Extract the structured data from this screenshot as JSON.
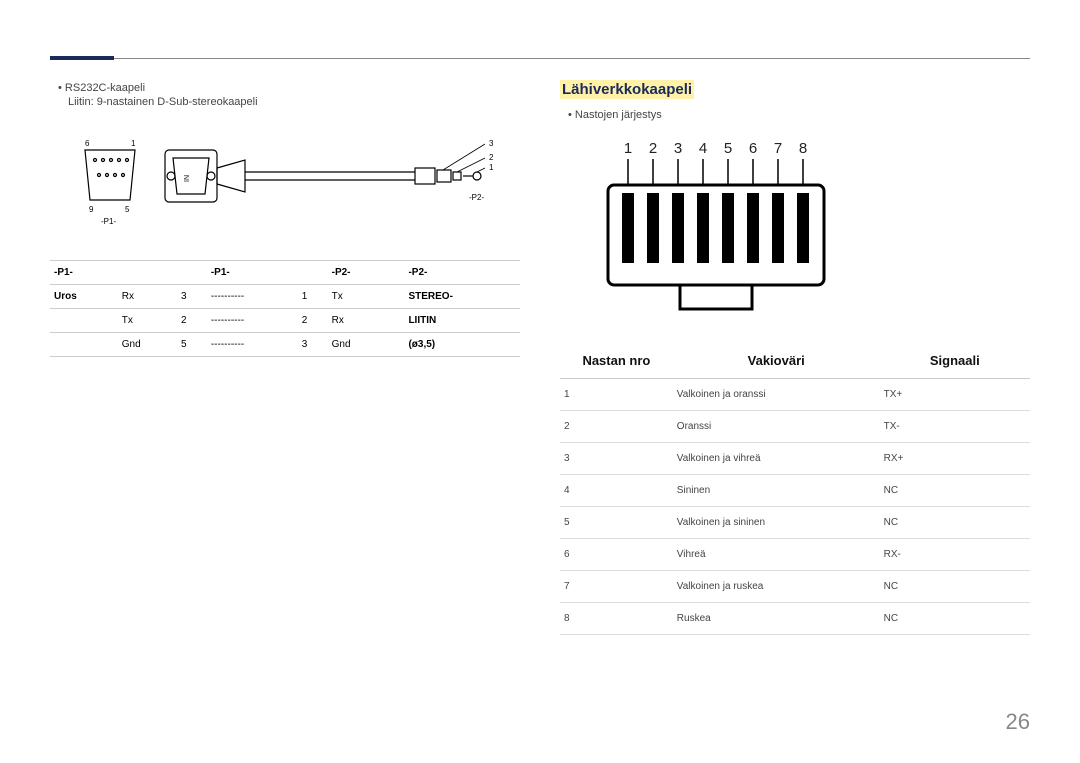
{
  "page_number": "26",
  "left": {
    "bullet": "RS232C-kaapeli",
    "subline": "Liitin: 9-nastainen D-Sub-stereokaapeli",
    "diagram": {
      "p1_label": "-P1-",
      "p2_label": "-P2-",
      "pin_labels_left": [
        "1",
        "5",
        "6",
        "9"
      ],
      "pin_labels_right": [
        "1",
        "2",
        "3"
      ]
    },
    "table": {
      "headers": [
        "-P1-",
        "-P1-",
        "-P2-",
        "-P2-"
      ],
      "col0_header": "Uros",
      "col7_header_rows": [
        "STEREO-",
        "LIITIN",
        "(ø3,5)"
      ],
      "rows": [
        [
          "Rx",
          "3",
          "----------",
          "1",
          "Tx"
        ],
        [
          "Tx",
          "2",
          "----------",
          "2",
          "Rx"
        ],
        [
          "Gnd",
          "5",
          "----------",
          "3",
          "Gnd"
        ]
      ]
    }
  },
  "right": {
    "title": "Lähiverkkokaapeli",
    "bullet": "Nastojen järjestys",
    "rj_pins": [
      "1",
      "2",
      "3",
      "4",
      "5",
      "6",
      "7",
      "8"
    ],
    "headers": {
      "pin": "Nastan nro",
      "color": "Vakioväri",
      "signal": "Signaali"
    },
    "rows": [
      {
        "pin": "1",
        "color": "Valkoinen ja oranssi",
        "signal": "TX+"
      },
      {
        "pin": "2",
        "color": "Oranssi",
        "signal": "TX-"
      },
      {
        "pin": "3",
        "color": "Valkoinen ja vihreä",
        "signal": "RX+"
      },
      {
        "pin": "4",
        "color": "Sininen",
        "signal": "NC"
      },
      {
        "pin": "5",
        "color": "Valkoinen ja sininen",
        "signal": "NC"
      },
      {
        "pin": "6",
        "color": "Vihreä",
        "signal": "RX-"
      },
      {
        "pin": "7",
        "color": "Valkoinen ja ruskea",
        "signal": "NC"
      },
      {
        "pin": "8",
        "color": "Ruskea",
        "signal": "NC"
      }
    ]
  }
}
